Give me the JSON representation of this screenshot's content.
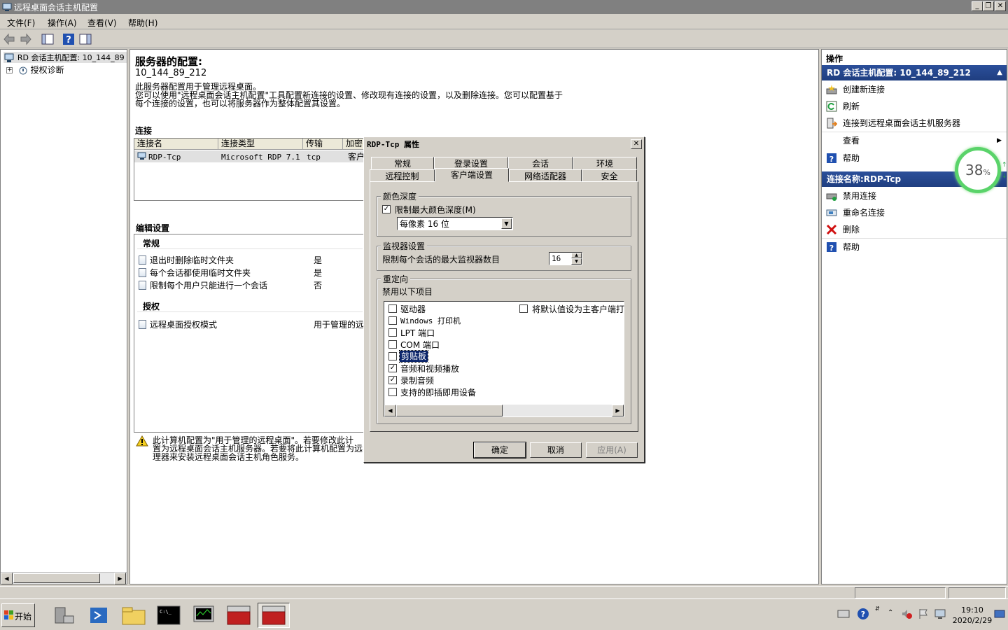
{
  "window": {
    "title": "远程桌面会话主机配置"
  },
  "menu": [
    "文件(F)",
    "操作(A)",
    "查看(V)",
    "帮助(H)"
  ],
  "tree": {
    "root": "RD 会话主机配置: 10_144_89",
    "child": "授权诊断"
  },
  "center": {
    "title": "服务器的配置:",
    "server": "10_144_89_212",
    "desc_line1": "此服务器配置用于管理远程桌面。",
    "desc_line2": "您可以使用\"远程桌面会话主机配置\"工具配置新连接的设置、修改现有连接的设置，以及删除连接。您可以配置基于",
    "desc_line3": "每个连接的设置，也可以将服务器作为整体配置其设置。",
    "connections_label": "连接",
    "columns": [
      "连接名",
      "连接类型",
      "传输",
      "加密"
    ],
    "row": {
      "name": "RDP-Tcp",
      "type": "Microsoft RDP 7.1",
      "transport": "tcp",
      "encryption": "客户"
    },
    "edit_label": "编辑设置",
    "general_label": "常规",
    "settings": [
      {
        "label": "退出时删除临时文件夹",
        "value": "是"
      },
      {
        "label": "每个会话都使用临时文件夹",
        "value": "是"
      },
      {
        "label": "限制每个用户只能进行一个会话",
        "value": "否"
      }
    ],
    "licensing_label": "授权",
    "licensing": {
      "label": "远程桌面授权模式",
      "value": "用于管理的远"
    },
    "warning_line1": "此计算机配置为\"用于管理的远程桌面\"。若要修改此计",
    "warning_line2": "置为远程桌面会话主机服务器。若要将此计算机配置为远",
    "warning_line3": "理器来安装远程桌面会话主机角色服务。"
  },
  "actions": {
    "header": "操作",
    "section1": "RD 会话主机配置: 10_144_89_212",
    "items1": [
      "创建新连接",
      "刷新",
      "连接到远程桌面会话主机服务器",
      "查看",
      "帮助"
    ],
    "section2": "连接名称:RDP-Tcp",
    "items2": [
      "禁用连接",
      "重命名连接",
      "删除",
      "帮助"
    ],
    "badge": "38",
    "badge_unit": "%"
  },
  "dialog": {
    "title": "RDP-Tcp 属性",
    "tabs_row1": [
      "常规",
      "登录设置",
      "会话",
      "环境"
    ],
    "tabs_row2": [
      "远程控制",
      "客户端设置",
      "网络适配器",
      "安全"
    ],
    "color_group": "颜色深度",
    "limit_color_label": "限制最大颜色深度(M)",
    "limit_color_checked": true,
    "color_select": "每像素 16 位",
    "monitor_group": "监视器设置",
    "monitor_label": "限制每个会话的最大监视器数目",
    "monitor_value": "16",
    "redirect_group": "重定向",
    "disable_label": "禁用以下项目",
    "items": [
      {
        "label": "驱动器",
        "checked": false
      },
      {
        "label": "Windows 打印机",
        "checked": false
      },
      {
        "label": "LPT 端口",
        "checked": false
      },
      {
        "label": "COM 端口",
        "checked": false
      },
      {
        "label": "剪贴板",
        "checked": false
      },
      {
        "label": "音频和视频播放",
        "checked": true
      },
      {
        "label": "录制音频",
        "checked": true
      },
      {
        "label": "支持的即插即用设备",
        "checked": false
      }
    ],
    "default_printer": "将默认值设为主客户端打",
    "ok": "确定",
    "cancel": "取消",
    "apply": "应用(A)"
  },
  "taskbar": {
    "start": "开始",
    "time": "19:10",
    "date": "2020/2/29"
  }
}
